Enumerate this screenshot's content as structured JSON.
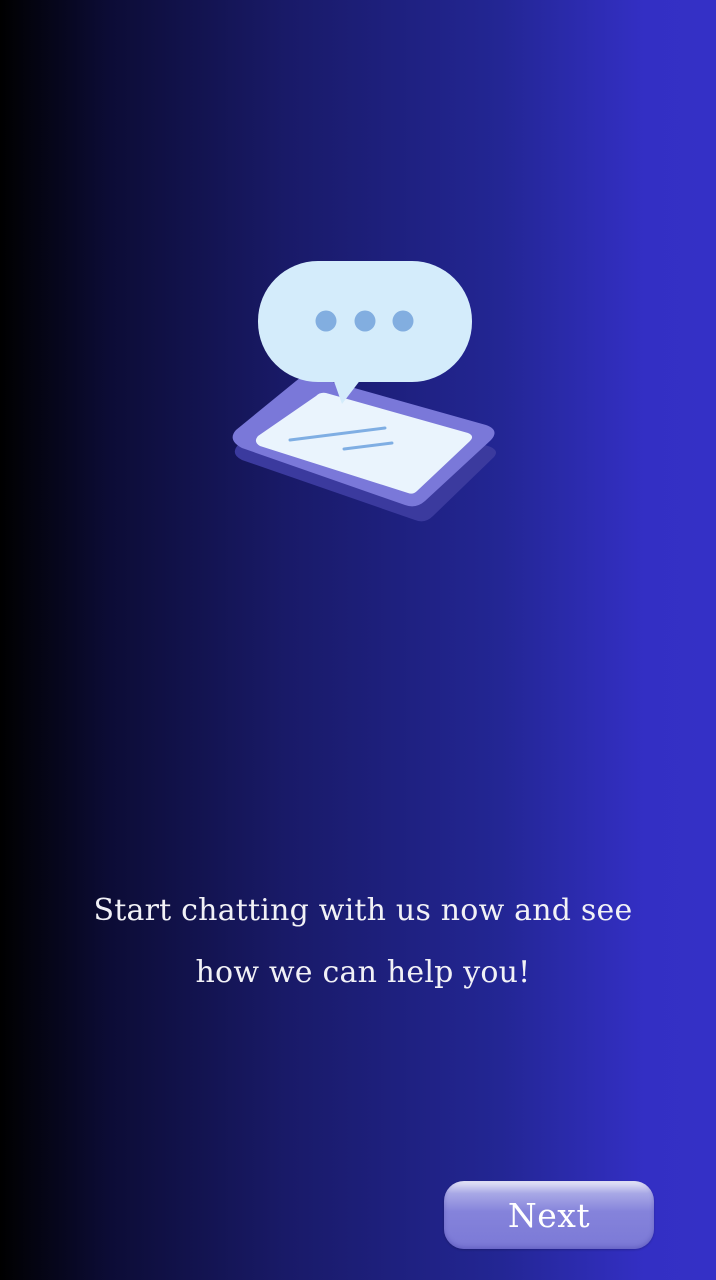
{
  "onboarding": {
    "illustration_icon": "chat-bubble-tablet-icon",
    "message_line1": "Start chatting with us now and see",
    "message_line2": "how we can help you!",
    "next_label": "Next"
  },
  "colors": {
    "background_left": "#000000",
    "background_right": "#3430c6",
    "bubble": "#d4ecfb",
    "bubble_dots": "#82aee0",
    "tablet_frame": "#7a78d9",
    "tablet_screen": "#eaf4fd",
    "button": "#7b79d6",
    "text": "#f1f1f6"
  }
}
